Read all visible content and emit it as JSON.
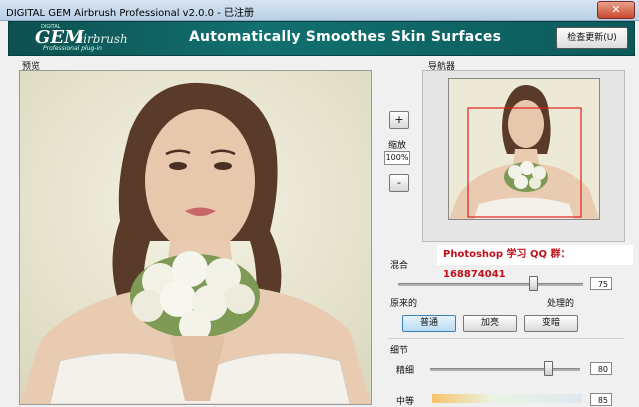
{
  "window": {
    "title": "DIGITAL GEM Airbrush Professional v2.0.0 - 已注册",
    "close_label": "✕"
  },
  "banner": {
    "logo_small": "DIGITAL",
    "logo_gem": "GEM",
    "logo_airbrush": "airbrush",
    "logo_sub": "Professional plug-in",
    "slogan": "Automatically Smoothes Skin Surfaces",
    "update_button": "检查更新(U)"
  },
  "preview": {
    "label": "预览"
  },
  "zoom": {
    "label": "缩放",
    "value": "100%",
    "plus": "+",
    "minus": "-"
  },
  "navigator": {
    "label": "导航器"
  },
  "watermark": "Photoshop 学习 QQ 群：168874041",
  "blend": {
    "label": "混合",
    "value": "75",
    "level": 0.75,
    "left_label": "原来的",
    "right_label": "处理的",
    "modes": [
      "普通",
      "加亮",
      "变暗"
    ],
    "selected_mode": "普通"
  },
  "detail": {
    "label": "细节",
    "fine_label": "精细",
    "fine_value": "80",
    "fine_level": 0.8,
    "medium_label": "中等",
    "medium_value": "85"
  },
  "colors": {
    "banner": "#127070",
    "watermark": "#c0101a",
    "selected_button": "#b9dcf2"
  }
}
